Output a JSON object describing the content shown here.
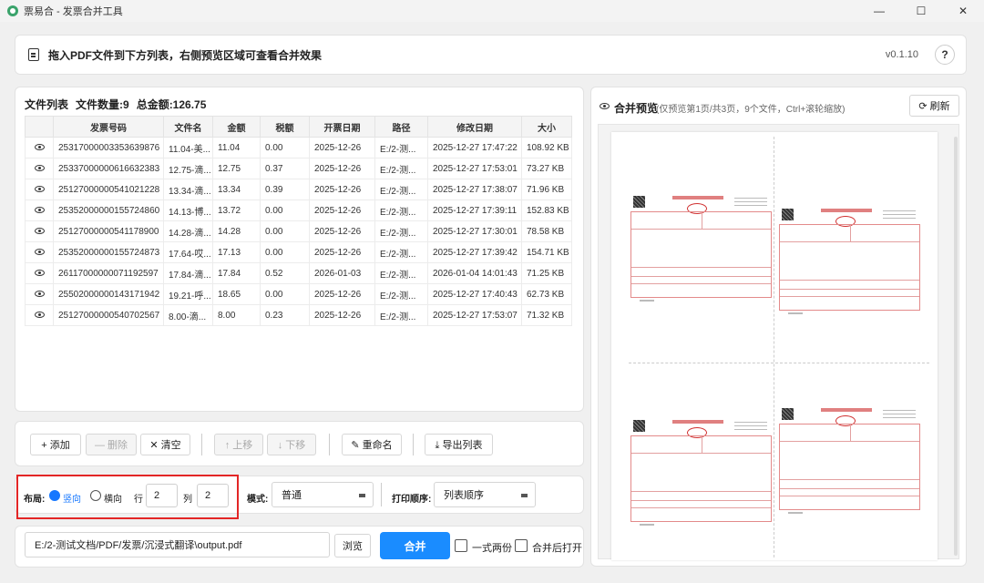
{
  "window": {
    "title": "票易合 - 发票合并工具",
    "controls": [
      "—",
      "☐",
      "✕"
    ]
  },
  "header": {
    "text": "拖入PDF文件到下方列表，右侧预览区域可查看合并效果",
    "version": "v0.1.10",
    "help": "?"
  },
  "filelist": {
    "title": "文件列表",
    "count": "文件数量:9",
    "total": "总金额:126.75",
    "columns": [
      "",
      "发票号码",
      "文件名",
      "金额",
      "税额",
      "开票日期",
      "路径",
      "修改日期",
      "大小"
    ],
    "rows": [
      [
        "25317000003353639876",
        "11.04-美...",
        "11.04",
        "0.00",
        "2025-12-26",
        "E:/2-测...",
        "2025-12-27 17:47:22",
        "108.92 KB"
      ],
      [
        "25337000000616632383",
        "12.75-滴...",
        "12.75",
        "0.37",
        "2025-12-26",
        "E:/2-测...",
        "2025-12-27 17:53:01",
        "73.27 KB"
      ],
      [
        "25127000000541021228",
        "13.34-滴...",
        "13.34",
        "0.39",
        "2025-12-26",
        "E:/2-测...",
        "2025-12-27 17:38:07",
        "71.96 KB"
      ],
      [
        "25352000000155724860",
        "14.13-博...",
        "13.72",
        "0.00",
        "2025-12-26",
        "E:/2-测...",
        "2025-12-27 17:39:11",
        "152.83 KB"
      ],
      [
        "25127000000541178900",
        "14.28-滴...",
        "14.28",
        "0.00",
        "2025-12-26",
        "E:/2-测...",
        "2025-12-27 17:30:01",
        "78.58 KB"
      ],
      [
        "25352000000155724873",
        "17.64-哎...",
        "17.13",
        "0.00",
        "2025-12-26",
        "E:/2-测...",
        "2025-12-27 17:39:42",
        "154.71 KB"
      ],
      [
        "26117000000071192597",
        "17.84-滴...",
        "17.84",
        "0.52",
        "2026-01-03",
        "E:/2-测...",
        "2026-01-04 14:01:43",
        "71.25 KB"
      ],
      [
        "25502000000143171942",
        "19.21-呼...",
        "18.65",
        "0.00",
        "2025-12-26",
        "E:/2-测...",
        "2025-12-27 17:40:43",
        "62.73 KB"
      ],
      [
        "25127000000540702567",
        "8.00-滴...",
        "8.00",
        "0.23",
        "2025-12-26",
        "E:/2-测...",
        "2025-12-27 17:53:07",
        "71.32 KB"
      ]
    ]
  },
  "toolbar": {
    "add": "+ 添加",
    "delete": "— 删除",
    "clear": "✕ 清空",
    "up": "↑ 上移",
    "down": "↓ 下移",
    "rename": "✎ 重命名",
    "export": "⤓ 导出列表"
  },
  "layout": {
    "label": "布局:",
    "portrait": "竖向",
    "landscape": "横向",
    "selected": "portrait",
    "rows_label": "行",
    "rows": "2",
    "cols_label": "列",
    "cols": "2",
    "mode_label": "模式:",
    "mode": "普通",
    "order_label": "打印顺序:",
    "order": "列表顺序"
  },
  "output": {
    "path": "E:/2-测试文档/PDF/发票/沉浸式翻译\\output.pdf",
    "browse": "浏览",
    "merge": "合并",
    "duplicate": "一式两份",
    "open_after": "合并后打开"
  },
  "preview": {
    "title": "合并预览",
    "subtitle": "(仅预览第1页/共3页，9个文件，Ctrl+滚轮缩放)",
    "refresh": "刷新"
  },
  "colors": {
    "accent": "#1a8cff",
    "highlight": "#e32626",
    "invoice_red": "#d03030"
  }
}
